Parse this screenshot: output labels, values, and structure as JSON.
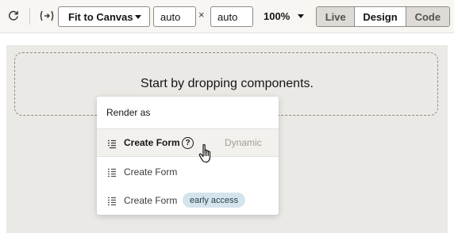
{
  "toolbar": {
    "refresh_icon": "refresh-icon",
    "expression_icon": "expression-icon",
    "fit_select_value": "Fit to Canvas",
    "width_value": "auto",
    "times_symbol": "×",
    "height_value": "auto",
    "zoom_value": "100%",
    "modes": [
      {
        "label": "Live",
        "active": false
      },
      {
        "label": "Design",
        "active": true
      },
      {
        "label": "Code",
        "active": false
      }
    ]
  },
  "canvas": {
    "drop_text": "Start by dropping components."
  },
  "render_menu": {
    "header": "Render as",
    "items": [
      {
        "label": "Create Form",
        "help_icon": "help-icon",
        "hint": "Dynamic",
        "selected": true
      },
      {
        "label": "Create Form"
      },
      {
        "label": "Create Form",
        "badge": "early access"
      }
    ]
  },
  "colors": {
    "toolbar_bg": "#f7f6f3",
    "canvas_bg": "#ebe9e5",
    "badge_bg": "#d4e4ec",
    "muted_button_bg": "#dedbd6"
  }
}
